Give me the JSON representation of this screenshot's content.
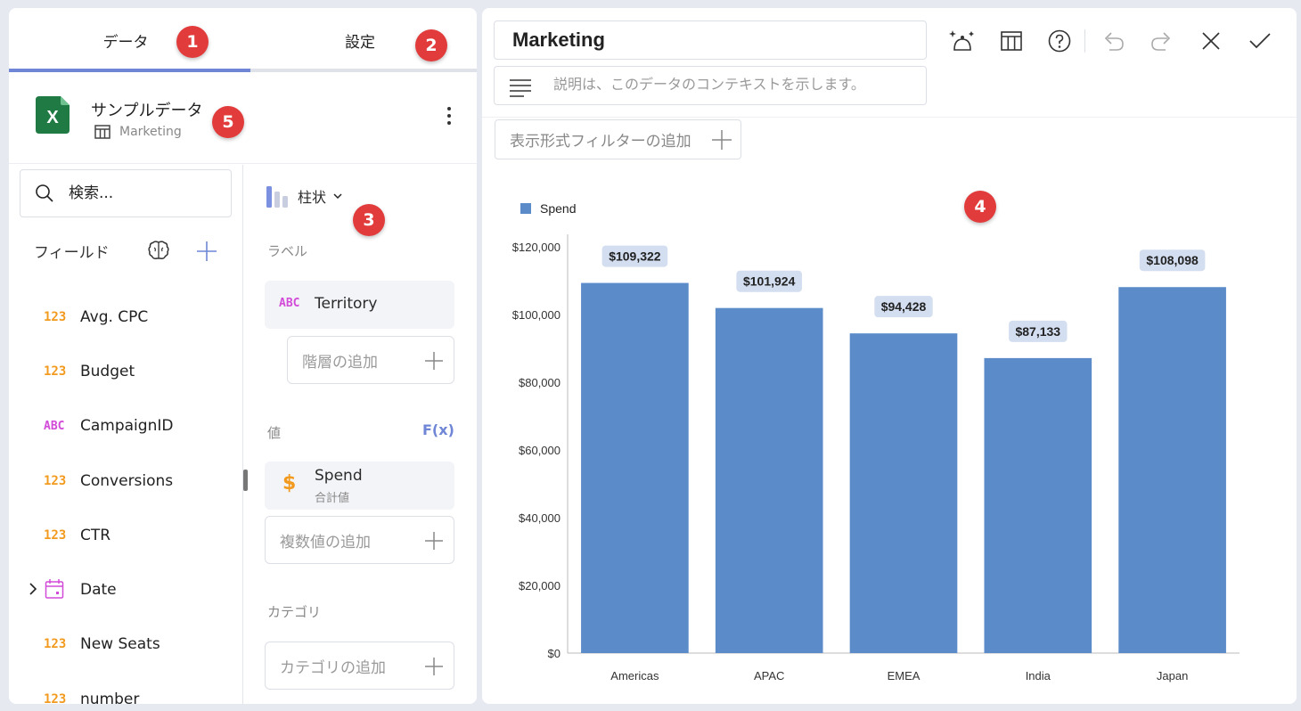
{
  "tabs": [
    {
      "label": "データ",
      "badge": "1"
    },
    {
      "label": "設定",
      "badge": "2"
    }
  ],
  "badges": {
    "chart_type": "3",
    "chart": "4",
    "source": "5"
  },
  "data_source": {
    "name": "サンプルデータ",
    "table": "Marketing",
    "icon": "excel-icon"
  },
  "search": {
    "placeholder": "検索..."
  },
  "fields_header": "フィールド",
  "fields": [
    {
      "type": "123",
      "name": "Avg. CPC"
    },
    {
      "type": "123",
      "name": "Budget"
    },
    {
      "type": "ABC",
      "name": "CampaignID"
    },
    {
      "type": "123",
      "name": "Conversions"
    },
    {
      "type": "123",
      "name": "CTR"
    },
    {
      "type": "date",
      "name": "Date"
    },
    {
      "type": "123",
      "name": "New Seats"
    },
    {
      "type": "123",
      "name": "number"
    }
  ],
  "config": {
    "chart_type": "柱状",
    "label_section": "ラベル",
    "label_field": {
      "type": "ABC",
      "name": "Territory"
    },
    "add_hierarchy": "階層の追加",
    "values_section": "値",
    "fx": "F(x)",
    "value_field": {
      "name": "Spend",
      "agg": "合計値",
      "icon": "$"
    },
    "add_values": "複数値の追加",
    "category_section": "カテゴリ",
    "add_category": "カテゴリの追加"
  },
  "editor": {
    "title": "Marketing",
    "description_placeholder": "説明は、このデータのコンテキストを示します。",
    "add_filter": "表示形式フィルターの追加"
  },
  "colors": {
    "accent": "#6f86d6",
    "bar": "#5b8bc9",
    "badge": "#e23b3b",
    "number_type": "#f29a1d",
    "text_type": "#d24ad8"
  },
  "chart_data": {
    "type": "bar",
    "categories": [
      "Americas",
      "APAC",
      "EMEA",
      "India",
      "Japan"
    ],
    "series": [
      {
        "name": "Spend",
        "values": [
          109322,
          101924,
          94428,
          87133,
          108098
        ]
      }
    ],
    "data_labels": [
      "$109,322",
      "$101,924",
      "$94,428",
      "$87,133",
      "$108,098"
    ],
    "y_ticks": [
      0,
      20000,
      40000,
      60000,
      80000,
      100000,
      120000
    ],
    "y_tick_labels": [
      "$0",
      "$20,000",
      "$40,000",
      "$60,000",
      "$80,000",
      "$100,000",
      "$120,000"
    ],
    "ylim": [
      0,
      120000
    ],
    "legend": "top-left",
    "grid": false
  }
}
